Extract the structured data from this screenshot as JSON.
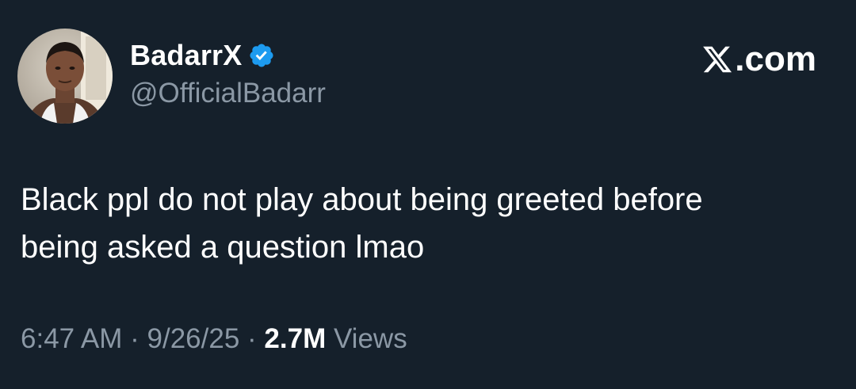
{
  "author": {
    "display_name": "BadarrX",
    "handle": "@OfficialBadarr",
    "verified": true,
    "avatar_icon": "profile-photo"
  },
  "brand": {
    "label": ".com",
    "logo_icon": "x-logo-icon"
  },
  "tweet": {
    "line1": "Black ppl do not play about being greeted before",
    "line2": "being asked a question lmao"
  },
  "meta": {
    "time": "6:47 AM",
    "separator": " · ",
    "date": "9/26/25",
    "views_count": "2.7M",
    "views_label": " Views"
  },
  "colors": {
    "background": "#15202b",
    "primary_text": "#ffffff",
    "secondary_text": "#8b98a5",
    "verified_blue": "#1d9bf0"
  }
}
